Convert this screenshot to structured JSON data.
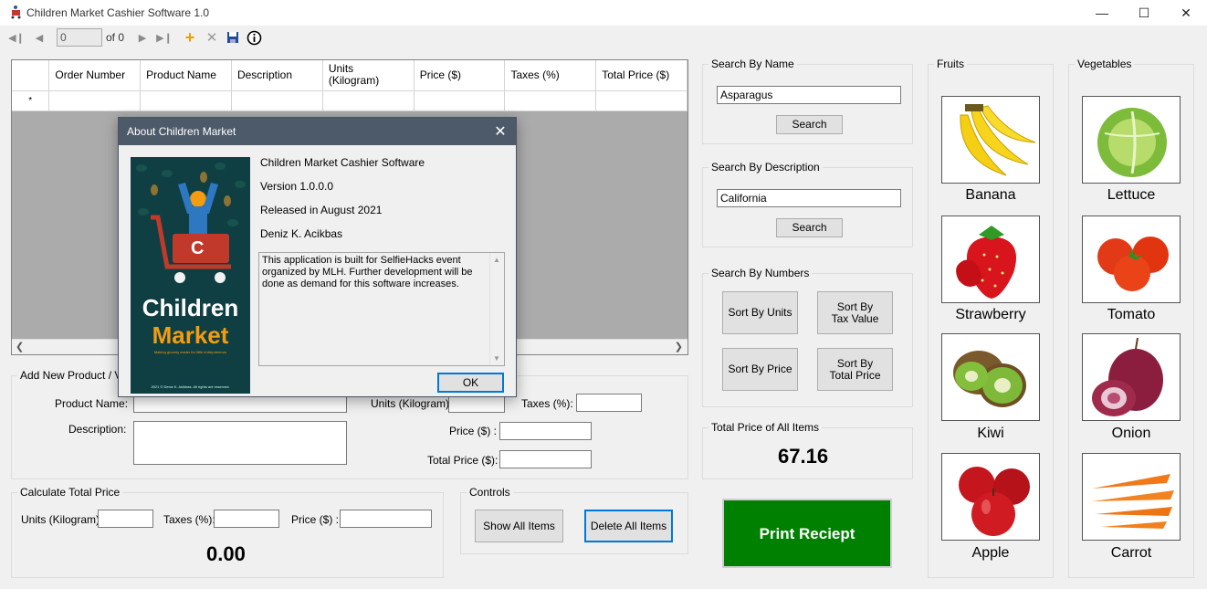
{
  "window": {
    "title": "Children Market Cashier Software 1.0"
  },
  "toolbar": {
    "position_value": "0",
    "of_label": "of 0"
  },
  "grid": {
    "columns": [
      "Order Number",
      "Product Name",
      "Description",
      "Units\n(Kilogram)",
      "Price ($)",
      "Taxes (%)",
      "Total Price ($)"
    ],
    "new_row_marker": "*"
  },
  "add_product": {
    "legend": "Add New Product / Vie",
    "product_name_label": "Product Name:",
    "description_label": "Description:",
    "units_label": "Units (Kilogram):",
    "taxes_label": "Taxes (%):",
    "price_label": "Price ($) :",
    "total_price_label": "Total Price ($):"
  },
  "calculate": {
    "legend": "Calculate Total Price",
    "units_label": "Units (Kilogram):",
    "taxes_label": "Taxes (%):",
    "price_label": "Price ($) :",
    "result": "0.00"
  },
  "controls": {
    "legend": "Controls",
    "show_all": "Show All Items",
    "delete_all": "Delete All Items"
  },
  "search_name": {
    "legend": "Search By Name",
    "value": "Asparagus",
    "button": "Search"
  },
  "search_desc": {
    "legend": "Search By Description",
    "value": "California",
    "button": "Search"
  },
  "search_numbers": {
    "legend": "Search By Numbers",
    "sort_units": "Sort By Units",
    "sort_tax": "Sort By Tax Value",
    "sort_price": "Sort By Price",
    "sort_total": "Sort By Total Price"
  },
  "total_all": {
    "legend": "Total Price of All Items",
    "value": "67.16"
  },
  "print_button": "Print Reciept",
  "fruits": {
    "legend": "Fruits",
    "items": [
      "Banana",
      "Strawberry",
      "Kiwi",
      "Apple"
    ]
  },
  "vegetables": {
    "legend": "Vegetables",
    "items": [
      "Lettuce",
      "Tomato",
      "Onion",
      "Carrot"
    ]
  },
  "about": {
    "title": "About Children Market",
    "product": "Children Market Cashier Software",
    "version": "Version 1.0.0.0",
    "released": "Released in August 2021",
    "author": "Deniz K. Acikbas",
    "description": "This application is built for SelfieHacks event organized by MLH. Further development will be done as demand for this software increases.",
    "ok": "OK",
    "logo_line1": "Children",
    "logo_line2": "Market",
    "logo_tagline": "Making grocery easier for little entrepreneurs",
    "logo_letter": "C",
    "logo_copyright": "2021 © Deniz K. Acikbas. All rights are reserved."
  },
  "colors": {
    "print_green": "#008000",
    "dialog_title": "#4d5a69",
    "logo_bg": "#0f3f43",
    "logo_orange": "#f39c12",
    "cart_red": "#c0392b"
  }
}
